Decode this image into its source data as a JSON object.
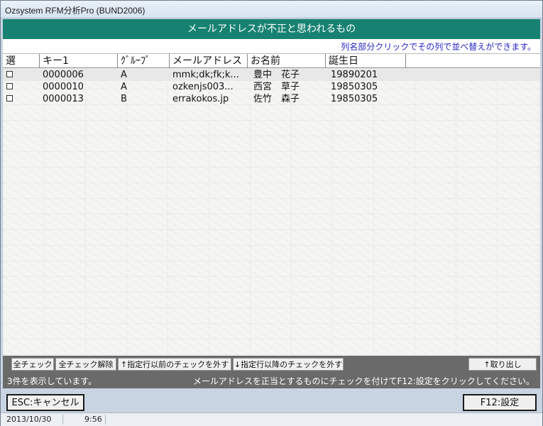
{
  "window": {
    "title": "Ozsystem RFM分析Pro (BUND2006)"
  },
  "header": {
    "title": "メールアドレスが不正と思われるもの"
  },
  "hint": "列名部分クリックでその列で並べ替えができます。",
  "grid": {
    "columns": [
      "選",
      "キー1",
      "ｸﾞﾙｰﾌﾟ",
      "メールアドレス",
      "お名前",
      "誕生日"
    ],
    "rows": [
      {
        "checked": false,
        "key": "0000006",
        "group": "A",
        "email": "mmk;dk;fk;k...",
        "name": "豊中　花子",
        "birthday": "19890201"
      },
      {
        "checked": false,
        "key": "0000010",
        "group": "A",
        "email": "ozkenjs003...",
        "name": "西宮　草子",
        "birthday": "19850305"
      },
      {
        "checked": false,
        "key": "0000013",
        "group": "B",
        "email": "errakokos.jp",
        "name": "佐竹　森子",
        "birthday": "19850305"
      }
    ]
  },
  "buttons": {
    "check_all": "全チェック",
    "uncheck_all": "全チェック解除",
    "uncheck_before": "↑指定行以前のチェックを外す",
    "uncheck_after": "↓指定行以降のチェックを外す",
    "extract": "↑取り出し"
  },
  "status": {
    "count": "3件を表示しています。",
    "message": "メールアドレスを正当とするものにチェックを付けてF12:設定をクリックしてください。"
  },
  "actions": {
    "cancel": "ESC:キャンセル",
    "settings": "F12:設定"
  },
  "statusbar": {
    "date": "2013/10/30",
    "time": "9:56"
  }
}
